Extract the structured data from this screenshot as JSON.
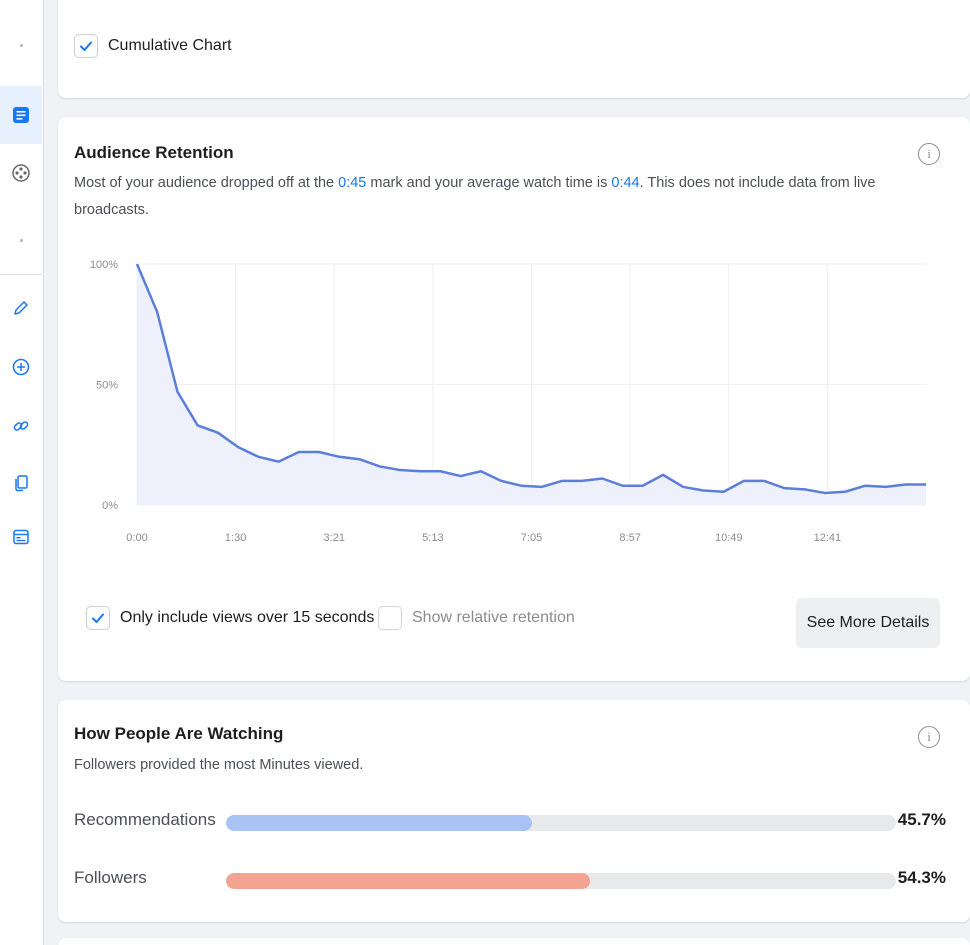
{
  "sidebar": {
    "icons": [
      "dot",
      "document-icon",
      "film-reel-icon",
      "dot",
      "pencil-icon",
      "plus-circle-icon",
      "link-icon",
      "copy-icon",
      "browser-icon"
    ],
    "active_color": "#1877f2"
  },
  "cumulative": {
    "label": "Cumulative Chart",
    "checked": true
  },
  "retention": {
    "title": "Audience Retention",
    "desc_before": "Most of your audience dropped off at the ",
    "dropoff_mark": "0:45",
    "desc_middle": " mark and your average watch time is ",
    "avg_watch": "0:44",
    "desc_after": ". This does not include data from live broadcasts.",
    "only_views_label": "Only include views over 15 seconds",
    "only_views_checked": true,
    "relative_label": "Show relative retention",
    "relative_checked": false,
    "details_button": "See More Details"
  },
  "chart_data": {
    "type": "area",
    "title": "",
    "y_ticks": [
      "100%",
      "50%",
      "0%"
    ],
    "ylim": [
      0,
      100
    ],
    "x_ticks": [
      "0:00",
      "1:30",
      "3:21",
      "5:13",
      "7:05",
      "8:57",
      "10:49",
      "12:41"
    ],
    "line_color": "#5b7fd8",
    "fill_color": "#eef1fb",
    "points": [
      [
        0,
        100
      ],
      [
        0.4,
        80
      ],
      [
        0.8,
        47
      ],
      [
        1.2,
        33
      ],
      [
        1.6,
        30
      ],
      [
        2.0,
        24
      ],
      [
        2.4,
        20
      ],
      [
        2.8,
        18
      ],
      [
        3.2,
        22
      ],
      [
        3.6,
        22
      ],
      [
        4.0,
        20
      ],
      [
        4.4,
        19
      ],
      [
        4.8,
        16
      ],
      [
        5.2,
        14.5
      ],
      [
        5.6,
        14
      ],
      [
        6.0,
        14
      ],
      [
        6.4,
        12
      ],
      [
        6.8,
        14
      ],
      [
        7.2,
        10
      ],
      [
        7.6,
        8
      ],
      [
        8.0,
        7.5
      ],
      [
        8.4,
        10
      ],
      [
        8.8,
        10
      ],
      [
        9.2,
        11
      ],
      [
        9.6,
        8
      ],
      [
        10.0,
        8
      ],
      [
        10.4,
        12.5
      ],
      [
        10.8,
        7.5
      ],
      [
        11.2,
        6
      ],
      [
        11.6,
        5.5
      ],
      [
        12.0,
        10
      ],
      [
        12.4,
        10
      ],
      [
        12.8,
        7
      ],
      [
        13.2,
        6.5
      ],
      [
        13.6,
        5
      ],
      [
        14.0,
        5.5
      ],
      [
        14.4,
        8
      ],
      [
        14.8,
        7.5
      ],
      [
        15.2,
        8.5
      ],
      [
        15.6,
        8.5
      ]
    ]
  },
  "watching": {
    "title": "How People Are Watching",
    "desc": "Followers provided the most Minutes viewed.",
    "rows": [
      {
        "label": "Recommendations",
        "value": 45.7,
        "pct": "45.7%",
        "color": "#a9c3f5"
      },
      {
        "label": "Followers",
        "value": 54.3,
        "pct": "54.3%",
        "color": "#f3a391"
      }
    ]
  }
}
